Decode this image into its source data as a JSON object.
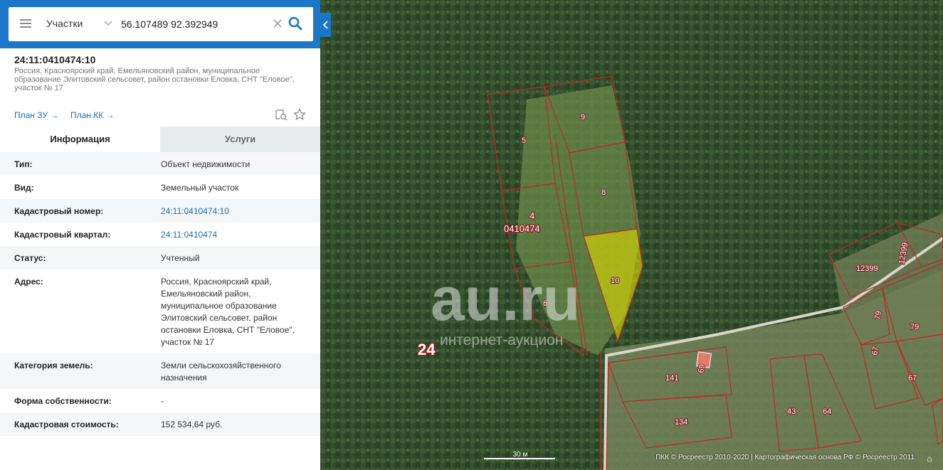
{
  "search": {
    "layer": "Участки",
    "query": "56.107489 92.392949"
  },
  "object": {
    "title": "24:11:0410474:10",
    "address": "Россия, Красноярский край, Емельяновский район, муниципальное образование Элитовский сельсовет, район остановки Еловка, СНТ \"Еловое\", участок № 17",
    "links": {
      "plan_zu": "План ЗУ →",
      "plan_kk": "План КК →"
    }
  },
  "tabs": [
    {
      "label": "Информация"
    },
    {
      "label": "Услуги"
    }
  ],
  "info_rows": [
    {
      "key": "Тип:",
      "value": "Объект недвижимости"
    },
    {
      "key": "Вид:",
      "value": "Земельный участок"
    },
    {
      "key": "Кадастровый номер:",
      "value": "24:11:0410474:10"
    },
    {
      "key": "Кадастровый квартал:",
      "value": "24:11:0410474"
    },
    {
      "key": "Статус:",
      "value": "Учтенный"
    },
    {
      "key": "Адрес:",
      "value": "Россия, Красноярский край, Емельяновский район, муниципальное образование Элитовский сельсовет, район остановки Еловка, СНТ \"Еловое\", участок № 17"
    },
    {
      "key": "Категория земель:",
      "value": "Земли сельскохозяйственного назначения"
    },
    {
      "key": "Форма собственности:",
      "value": "-"
    },
    {
      "key": "Кадастровая стоимость:",
      "value": "152 534,64 руб."
    }
  ],
  "map": {
    "parcel_labels": [
      "5",
      "9",
      "8",
      "4",
      "10",
      "6",
      "12399",
      "12399",
      "79",
      "79",
      "67",
      "141",
      "69",
      "134",
      "43",
      "64",
      "67"
    ],
    "quarter_label": "0410474",
    "region_label": "24",
    "watermark": {
      "main": "au.ru",
      "sub": "интернет-аукцион"
    },
    "scale": "30 м",
    "attribution": "ПКК © Росреестр 2010-2020 | Картографическая основа РФ © Росреестр 2011",
    "highlight_color": "#d8d800",
    "boundary_color": "#c0282a"
  },
  "colors": {
    "accent": "#1a77c9",
    "link": "#1a6fb8"
  }
}
